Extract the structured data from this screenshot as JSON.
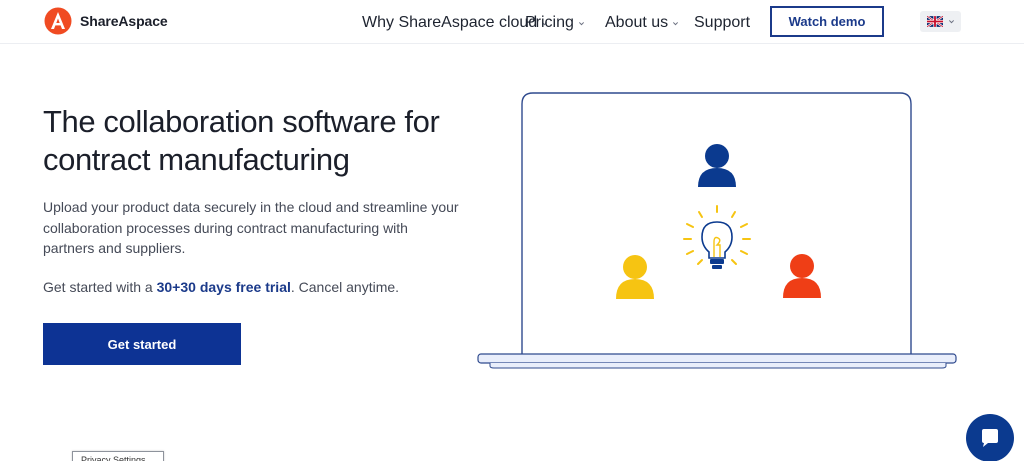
{
  "header": {
    "brand": "ShareAspace",
    "nav": [
      {
        "label": "Why ShareAspace cloud",
        "has_dropdown": true
      },
      {
        "label": "Pricing",
        "has_dropdown": true
      },
      {
        "label": "About us",
        "has_dropdown": true
      },
      {
        "label": "Support",
        "has_dropdown": false
      }
    ],
    "watch_demo_label": "Watch demo",
    "language_icon": "uk-flag-icon"
  },
  "hero": {
    "title": "The collaboration software for contract manufacturing",
    "description": "Upload your product data securely in the cloud and streamline your collaboration processes during contract manufacturing with partners and suppliers.",
    "trial_prefix": "Get started with a ",
    "trial_link": "30+30 days free trial",
    "trial_suffix": ". Cancel anytime.",
    "cta_label": "Get started"
  },
  "illustration": {
    "icons": [
      "laptop-icon",
      "person-blue-icon",
      "lightbulb-icon",
      "person-yellow-icon",
      "person-red-icon"
    ]
  },
  "privacy_tab": {
    "label": "Privacy Settings"
  },
  "colors": {
    "brand_blue": "#0d3394",
    "logo_orange": "#f04b22",
    "person_blue": "#0b3a8f",
    "person_yellow": "#f6c412",
    "person_red": "#ef3e16"
  }
}
